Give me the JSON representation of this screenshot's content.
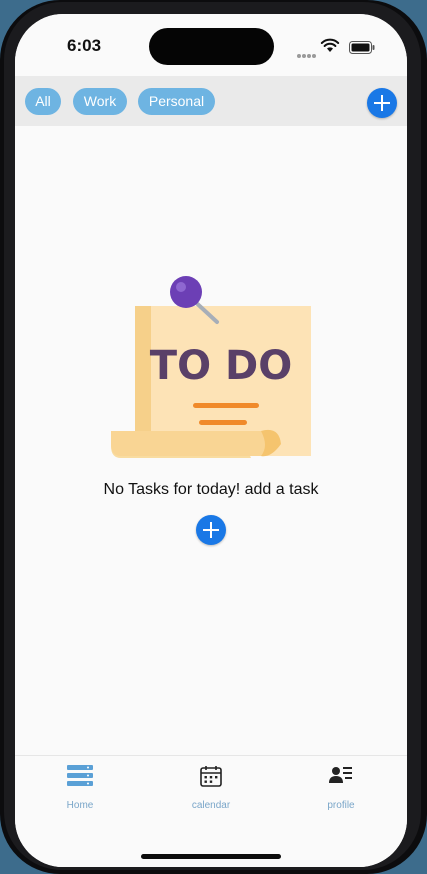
{
  "status_bar": {
    "time": "6:03"
  },
  "filters": {
    "all": "All",
    "work": "Work",
    "personal": "Personal"
  },
  "illustration": {
    "word": "TO DO"
  },
  "empty_state": {
    "message": "No Tasks for today! add a task"
  },
  "tabs": [
    {
      "label": "Home",
      "icon": "home-list-icon"
    },
    {
      "label": "calendar",
      "icon": "calendar-icon"
    },
    {
      "label": "profile",
      "icon": "profile-icon"
    }
  ],
  "colors": {
    "accent": "#1a78e6",
    "chip": "#6eb4e2",
    "tab_label": "#7aa6c9"
  }
}
